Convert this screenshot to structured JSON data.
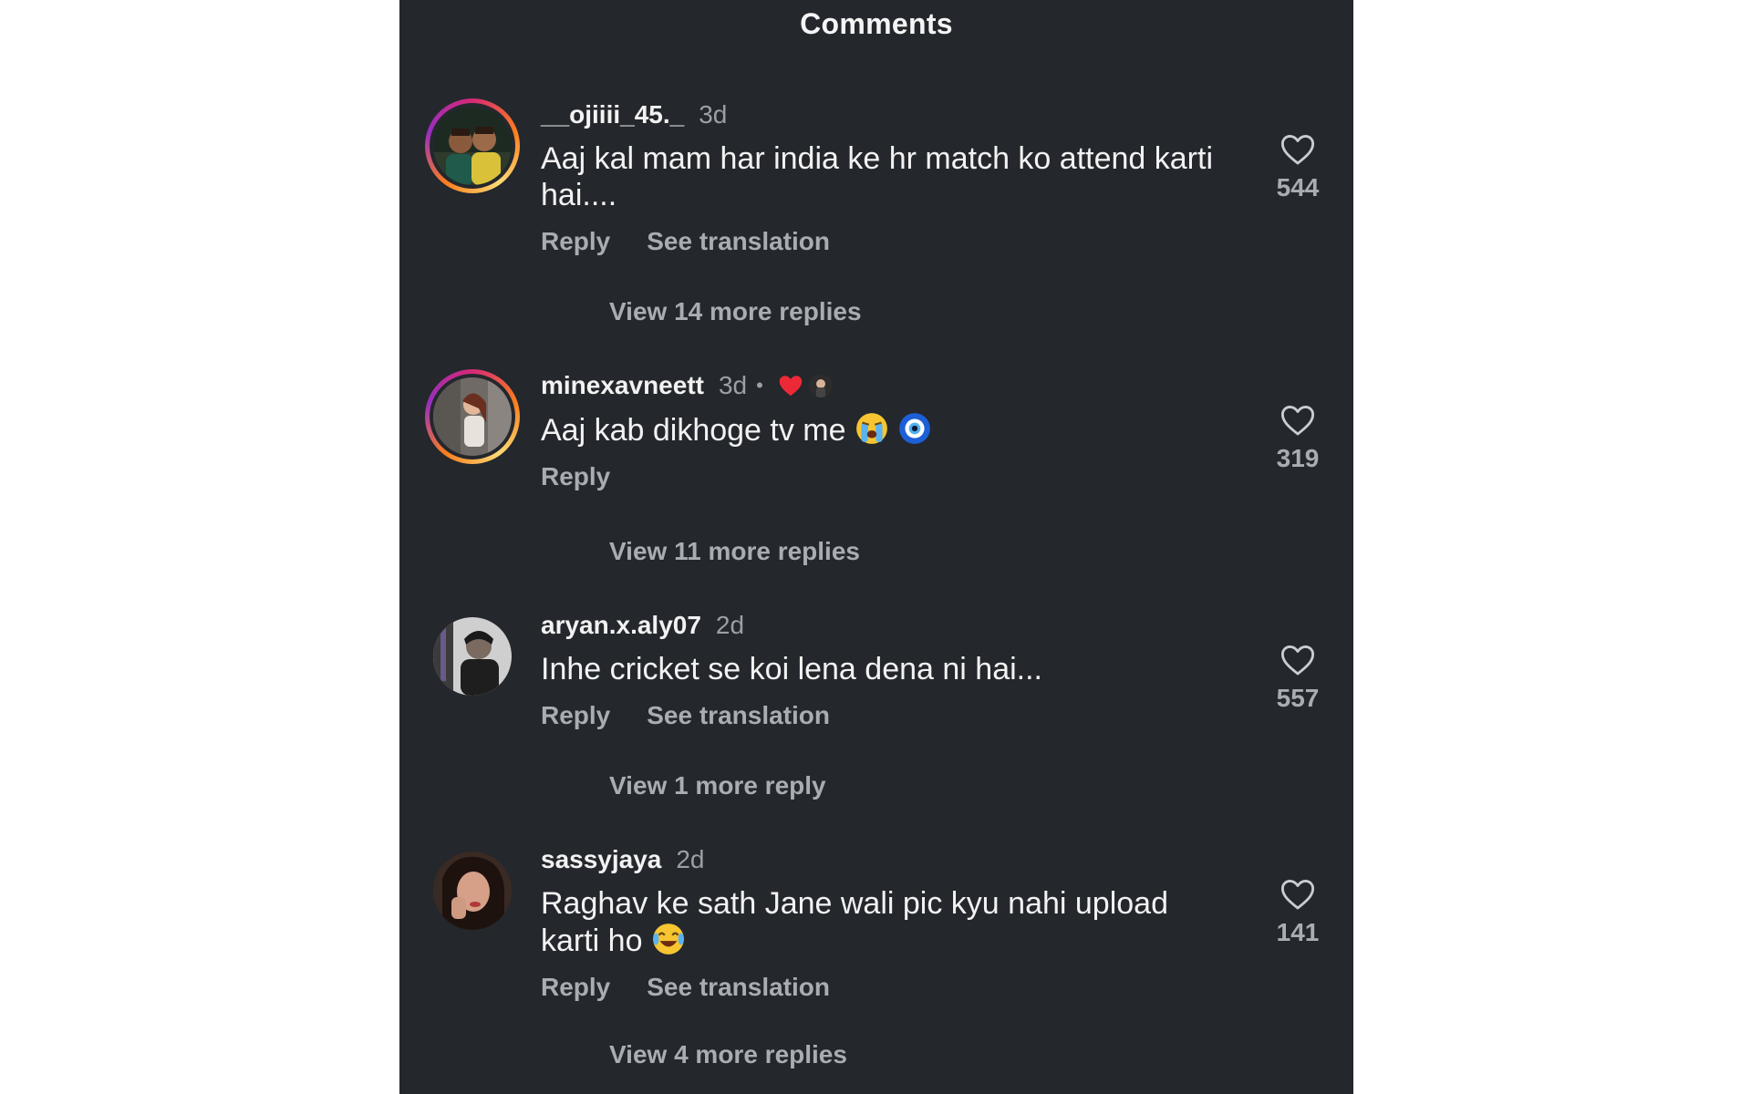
{
  "header": {
    "title": "Comments"
  },
  "comments": [
    {
      "username": "__ojiiii_45._",
      "time": "3d",
      "text": "Aaj kal mam har  india ke hr match ko attend karti hai....",
      "reply_label": "Reply",
      "translate_label": "See translation",
      "likes": "544",
      "view_replies": "View 14 more replies"
    },
    {
      "username": "minexavneett",
      "time": "3d",
      "separator": "•",
      "text": "Aaj kab dikhoge tv me",
      "reply_label": "Reply",
      "likes": "319",
      "view_replies": "View 11 more replies"
    },
    {
      "username": "aryan.x.aly07",
      "time": "2d",
      "text": "Inhe cricket se koi lena dena ni hai...",
      "reply_label": "Reply",
      "translate_label": "See translation",
      "likes": "557",
      "view_replies": "View 1 more reply"
    },
    {
      "username": "sassyjaya",
      "time": "2d",
      "text": "Raghav ke sath Jane wali pic kyu nahi upload karti ho",
      "reply_label": "Reply",
      "translate_label": "See translation",
      "likes": "141",
      "view_replies": "View 4 more replies"
    }
  ],
  "icons": {
    "like": "heart-outline-icon",
    "creator_liked": "red-heart-icon",
    "emoji_cry": "loudly-crying-face-emoji",
    "emoji_nazar": "nazar-amulet-emoji",
    "emoji_laugh": "face-with-tears-of-joy-emoji"
  },
  "colors": {
    "background": "#24272c",
    "text": "#f2f2f2",
    "muted": "#a9adb3",
    "red_heart": "#ed2938"
  }
}
